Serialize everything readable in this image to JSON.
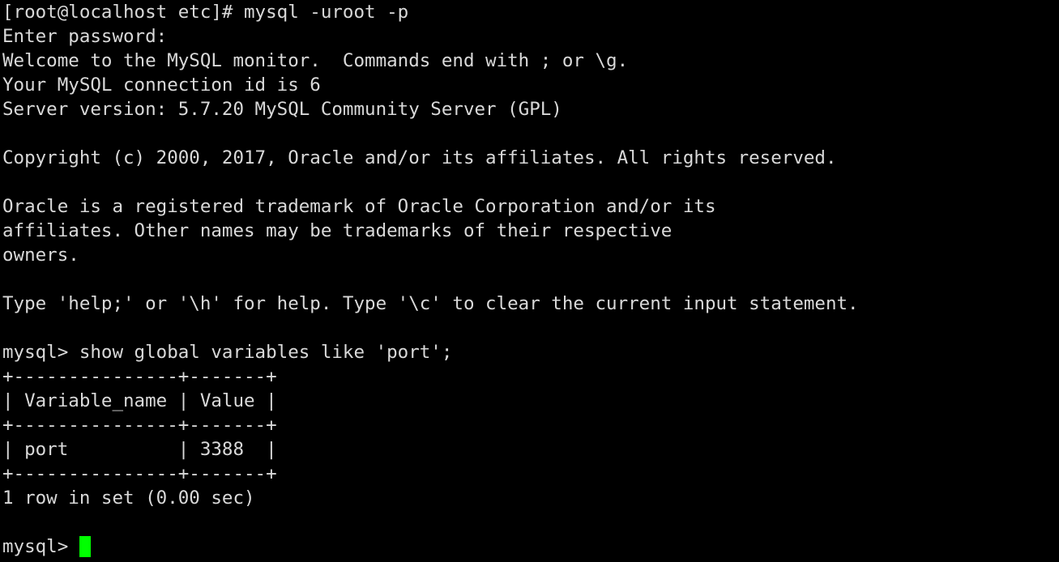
{
  "terminal": {
    "background_color": "#000000",
    "foreground_color": "#d9d9d9",
    "cursor_color": "#00ff00",
    "lines": [
      "[root@localhost etc]# mysql -uroot -p",
      "Enter password:",
      "Welcome to the MySQL monitor.  Commands end with ; or \\g.",
      "Your MySQL connection id is 6",
      "Server version: 5.7.20 MySQL Community Server (GPL)",
      "",
      "Copyright (c) 2000, 2017, Oracle and/or its affiliates. All rights reserved.",
      "",
      "Oracle is a registered trademark of Oracle Corporation and/or its",
      "affiliates. Other names may be trademarks of their respective",
      "owners.",
      "",
      "Type 'help;' or '\\h' for help. Type '\\c' to clear the current input statement.",
      "",
      "mysql> show global variables like 'port';",
      "+---------------+-------+",
      "| Variable_name | Value |",
      "+---------------+-------+",
      "| port          | 3388  |",
      "+---------------+-------+",
      "1 row in set (0.00 sec)",
      ""
    ],
    "prompt": {
      "text": "mysql> ",
      "cursor": "block-cursor"
    },
    "shell_prompt": "[root@localhost etc]#",
    "command": "mysql -uroot -p",
    "password_prompt": "Enter password:",
    "mysql_banner": {
      "welcome": "Welcome to the MySQL monitor.  Commands end with ; or \\g.",
      "connection_id_label": "Your MySQL connection id is 6",
      "connection_id": "6",
      "server_version_label": "Server version: 5.7.20 MySQL Community Server (GPL)",
      "server_version": "5.7.20",
      "server_edition": "MySQL Community Server (GPL)",
      "copyright": "Copyright (c) 2000, 2017, Oracle and/or its affiliates. All rights reserved.",
      "trademark_line1": "Oracle is a registered trademark of Oracle Corporation and/or its",
      "trademark_line2": "affiliates. Other names may be trademarks of their respective",
      "trademark_line3": "owners.",
      "help_hint": "Type 'help;' or '\\h' for help. Type '\\c' to clear the current input statement."
    },
    "query": {
      "prompt": "mysql>",
      "sql": "show global variables like 'port';",
      "full_line": "mysql> show global variables like 'port';"
    },
    "result_table": {
      "top_border": "+---------------+-------+",
      "header_row": "| Variable_name | Value |",
      "header_separator": "+---------------+-------+",
      "data_rows": [
        "| port          | 3388  |"
      ],
      "bottom_border": "+---------------+-------+",
      "columns": [
        "Variable_name",
        "Value"
      ],
      "rows": [
        [
          "port",
          "3388"
        ]
      ],
      "footer": "1 row in set (0.00 sec)",
      "row_count": "1",
      "elapsed": "0.00 sec"
    }
  }
}
